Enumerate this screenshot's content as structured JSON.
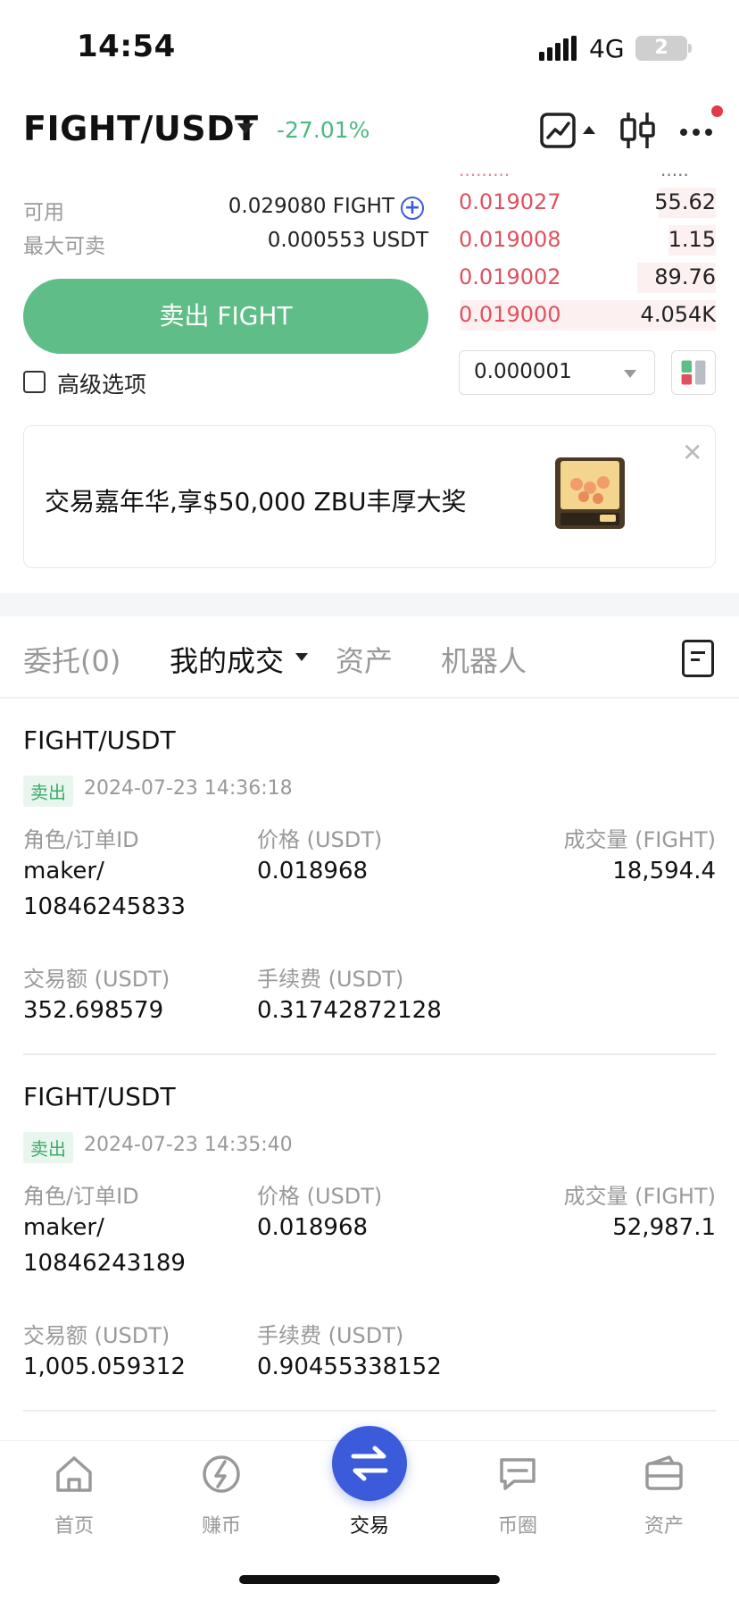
{
  "status_bar": {
    "time": "14:54",
    "network": "4G",
    "battery": "2"
  },
  "header": {
    "pair": "FIGHT/USDT",
    "change": "-27.01%"
  },
  "balances": {
    "available_label": "可用",
    "available_value": "0.029080 FIGHT",
    "max_sell_label": "最大可卖",
    "max_sell_value": "0.000553 USDT"
  },
  "sell_button": "卖出 FIGHT",
  "advanced_label": "高级选项",
  "orderbook": {
    "asks": [
      {
        "price": "0.019027",
        "qty": "55.62",
        "depth": 0.22
      },
      {
        "price": "0.019008",
        "qty": "1.15",
        "depth": 0.18
      },
      {
        "price": "0.019002",
        "qty": "89.76",
        "depth": 0.3
      },
      {
        "price": "0.019000",
        "qty": "4.054K",
        "depth": 0.98
      }
    ],
    "precision": "0.000001"
  },
  "banner": {
    "text": "交易嘉年华,享$50,000 ZBU丰厚大奖"
  },
  "tabs": {
    "orders": "委托(0)",
    "my_trades": "我的成交",
    "assets": "资产",
    "bots": "机器人"
  },
  "trades": [
    {
      "pair": "FIGHT/USDT",
      "side": "卖出",
      "time": "2024-07-23 14:36:18",
      "role_label": "角色/订单ID",
      "role_value": "maker/",
      "order_id": "10846245833",
      "price_label": "价格 (USDT)",
      "price_value": "0.018968",
      "volume_label": "成交量 (FIGHT)",
      "volume_value": "18,594.4",
      "amount_label": "交易额 (USDT)",
      "amount_value": "352.698579",
      "fee_label": "手续费 (USDT)",
      "fee_value": "0.31742872128"
    },
    {
      "pair": "FIGHT/USDT",
      "side": "卖出",
      "time": "2024-07-23 14:35:40",
      "role_label": "角色/订单ID",
      "role_value": "maker/",
      "order_id": "10846243189",
      "price_label": "价格 (USDT)",
      "price_value": "0.018968",
      "volume_label": "成交量 (FIGHT)",
      "volume_value": "52,987.1",
      "amount_label": "交易额 (USDT)",
      "amount_value": "1,005.059312",
      "fee_label": "手续费 (USDT)",
      "fee_value": "0.90455338152"
    }
  ],
  "bottom_nav": {
    "home": "首页",
    "earn": "赚币",
    "trade": "交易",
    "community": "币圈",
    "assets": "资产"
  },
  "colors": {
    "accent": "#3b5bdb",
    "buy_green": "#5fbd87",
    "sell_red": "#e0505e"
  }
}
